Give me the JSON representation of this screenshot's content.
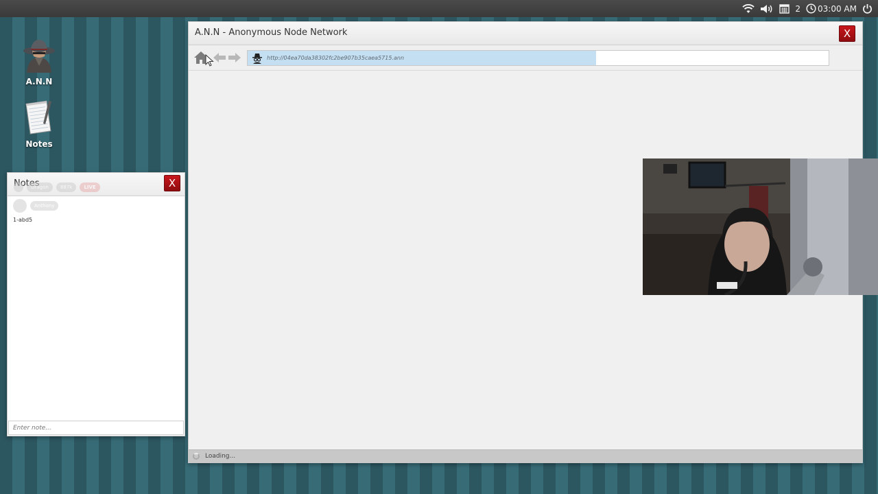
{
  "system_tray": {
    "notification_count": "2",
    "time": "03:00 AM",
    "icons": [
      "wifi-icon",
      "volume-icon",
      "calendar-icon",
      "clock-icon",
      "power-icon"
    ]
  },
  "desktop": {
    "icons": [
      {
        "label": "A.N.N",
        "icon": "spy-agent-icon"
      },
      {
        "label": "Notes",
        "icon": "notepad-icon"
      }
    ]
  },
  "ann_window": {
    "title": "A.N.N - Anonymous Node Network",
    "close_label": "X",
    "url": "http://04ea70da38302fc2be907b35caea5715.ann",
    "load_progress": 0.6,
    "status": "Loading..."
  },
  "notes_window": {
    "title": "Notes",
    "close_label": "X",
    "overlay_chips": {
      "row1": [
        "Dragon",
        "887k"
      ],
      "live": "LIVE",
      "row2": [
        "Anthony"
      ]
    },
    "notes": [
      "1-abd5"
    ],
    "input_placeholder": "Enter note..."
  },
  "colors": {
    "close_red": "#b3121a",
    "desktop_stripe_a": "#2c5660",
    "desktop_stripe_b": "#376b76",
    "url_progress": "#c5dff2"
  }
}
